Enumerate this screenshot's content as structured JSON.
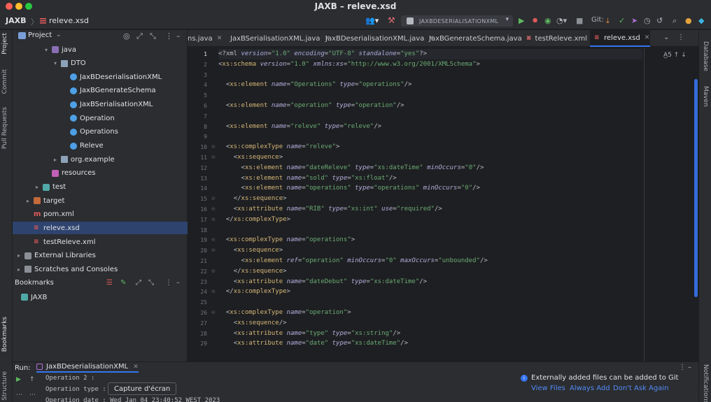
{
  "window": {
    "title": "JAXB – releve.xsd"
  },
  "toolbar": {
    "project": "JAXB",
    "separator": "〉",
    "file": "releve.xsd",
    "run_config": "JAXBDESERIALISATIONXML",
    "git_label": "Git:",
    "icons": [
      "user-icon",
      "hammer-icon",
      "run-icon",
      "debug-icon",
      "coverage-icon",
      "profile-icon",
      "stop-icon",
      "git-update-icon",
      "git-commit-icon",
      "git-push-icon",
      "history-icon",
      "rollback-icon",
      "search-icon",
      "update-icon",
      "settings-icon"
    ]
  },
  "left_strip": {
    "project": "Project",
    "commit": "Commit",
    "pull_requests": "Pull Requests",
    "bookmarks": "Bookmarks",
    "structure": "Structure"
  },
  "right_strip": {
    "database": "Database",
    "maven": "Maven",
    "notifications": "Notifications"
  },
  "project_panel": {
    "title": "Project",
    "tree": [
      {
        "label": "java",
        "depth": 2,
        "arrow": "▾",
        "icon": "folder-java"
      },
      {
        "label": "DTO",
        "depth": 3,
        "arrow": "▾",
        "icon": "folder"
      },
      {
        "label": "JaxBDeserialisationXML",
        "depth": 4,
        "arrow": "",
        "icon": "class"
      },
      {
        "label": "JaxBGenerateSchema",
        "depth": 4,
        "arrow": "",
        "icon": "class"
      },
      {
        "label": "JaxBSerialisationXML",
        "depth": 4,
        "arrow": "",
        "icon": "class"
      },
      {
        "label": "Operation",
        "depth": 4,
        "arrow": "",
        "icon": "class"
      },
      {
        "label": "Operations",
        "depth": 4,
        "arrow": "",
        "icon": "class"
      },
      {
        "label": "Releve",
        "depth": 4,
        "arrow": "",
        "icon": "class"
      },
      {
        "label": "org.example",
        "depth": 3,
        "arrow": "▸",
        "icon": "folder"
      },
      {
        "label": "resources",
        "depth": 2,
        "arrow": "",
        "icon": "folder-purple"
      },
      {
        "label": "test",
        "depth": 1,
        "arrow": "▸",
        "icon": "folder-teal"
      },
      {
        "label": "target",
        "depth": 0,
        "arrow": "▸",
        "icon": "folder-orange"
      },
      {
        "label": "pom.xml",
        "depth": 0,
        "arrow": "",
        "icon": "maven"
      },
      {
        "label": "releve.xsd",
        "depth": 0,
        "arrow": "",
        "icon": "xml",
        "selected": true
      },
      {
        "label": "testReleve.xml",
        "depth": 0,
        "arrow": "",
        "icon": "xml"
      },
      {
        "label": "External Libraries",
        "depth": -1,
        "arrow": "▸",
        "icon": "lib"
      },
      {
        "label": "Scratches and Consoles",
        "depth": -1,
        "arrow": "▸",
        "icon": "scratch"
      }
    ],
    "bookmarks_title": "Bookmarks",
    "bookmarks": [
      {
        "label": "JAXB"
      }
    ]
  },
  "editor": {
    "tabs": [
      {
        "label": "ns.java",
        "icon": "class",
        "active": false
      },
      {
        "label": "JaxBSerialisationXML.java",
        "icon": "class",
        "active": false
      },
      {
        "label": "JaxBDeserialisationXML.java",
        "icon": "class",
        "active": false
      },
      {
        "label": "JaxBGenerateSchema.java",
        "icon": "class",
        "active": false
      },
      {
        "label": "testReleve.xml",
        "icon": "xml",
        "active": false
      },
      {
        "label": "releve.xsd",
        "icon": "xml",
        "active": true
      }
    ],
    "warnings": "A̲5",
    "current_line": 1,
    "lines": [
      "<?xml version=\"1.0\" encoding=\"UTF-8\" standalone=\"yes\"?>",
      "<xs:schema version=\"1.0\" xmlns:xs=\"http://www.w3.org/2001/XMLSchema\">",
      "",
      "  <xs:element name=\"Operations\" type=\"operations\"/>",
      "",
      "  <xs:element name=\"operation\" type=\"operation\"/>",
      "",
      "  <xs:element name=\"releve\" type=\"releve\"/>",
      "",
      "  <xs:complexType name=\"releve\">",
      "    <xs:sequence>",
      "      <xs:element name=\"dateReleve\" type=\"xs:dateTime\" minOccurs=\"0\"/>",
      "      <xs:element name=\"sold\" type=\"xs:float\"/>",
      "      <xs:element name=\"operations\" type=\"operations\" minOccurs=\"0\"/>",
      "    </xs:sequence>",
      "    <xs:attribute name=\"RIB\" type=\"xs:int\" use=\"required\"/>",
      "  </xs:complexType>",
      "",
      "  <xs:complexType name=\"operations\">",
      "    <xs:sequence>",
      "      <xs:element ref=\"operation\" minOccurs=\"0\" maxOccurs=\"unbounded\"/>",
      "    </xs:sequence>",
      "    <xs:attribute name=\"dateDebut\" type=\"xs:dateTime\"/>",
      "  </xs:complexType>",
      "",
      "  <xs:complexType name=\"operation\">",
      "    <xs:sequence/>",
      "    <xs:attribute name=\"type\" type=\"xs:string\"/>",
      "    <xs:attribute name=\"date\" type=\"xs:dateTime\"/>"
    ],
    "folds": {
      "10": "⊖",
      "11": "⊖",
      "15": "⊖",
      "16": "⊖",
      "17": "⊖",
      "19": "⊖",
      "20": "⊖",
      "22": "⊖",
      "24": "⊖",
      "26": "⊖"
    }
  },
  "run_panel": {
    "label": "Run:",
    "tab": "JaxBDeserialisationXML",
    "console": [
      "Operation 2 :",
      "Operation type :",
      "Operation date : Wed Jan 04 23:40:52 WEST 2023"
    ]
  },
  "tooltip": "Capture d'écran",
  "notification": {
    "message": "Externally added files can be added to Git",
    "actions": [
      "View Files",
      "Always Add",
      "Don't Ask Again"
    ]
  },
  "colors": {
    "accent": "#3574f0",
    "tag": "#d5b778",
    "attr": "#b2aede",
    "value": "#6aab73",
    "link": "#548af7"
  }
}
